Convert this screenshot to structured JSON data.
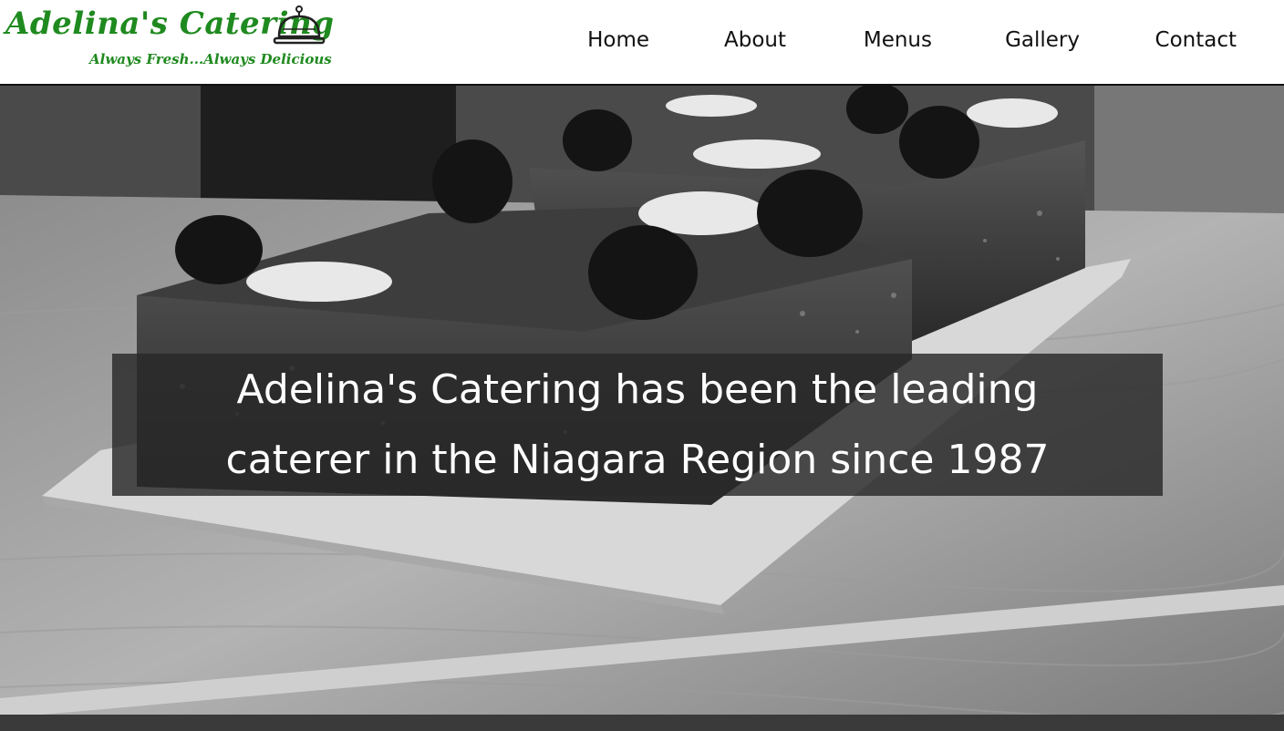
{
  "brand": {
    "name": "Adelina's Catering",
    "tagline": "Always Fresh...Always Delicious",
    "logo_icon": "cloche-icon",
    "color": "#1f8a1f"
  },
  "nav": {
    "items": [
      {
        "label": "Home"
      },
      {
        "label": "About"
      },
      {
        "label": "Menus"
      },
      {
        "label": "Gallery"
      },
      {
        "label": "Contact"
      }
    ]
  },
  "hero": {
    "image": "black-and-white-cake-photo",
    "caption": "Adelina's Catering has been the leading caterer in the Niagara Region since 1987"
  }
}
